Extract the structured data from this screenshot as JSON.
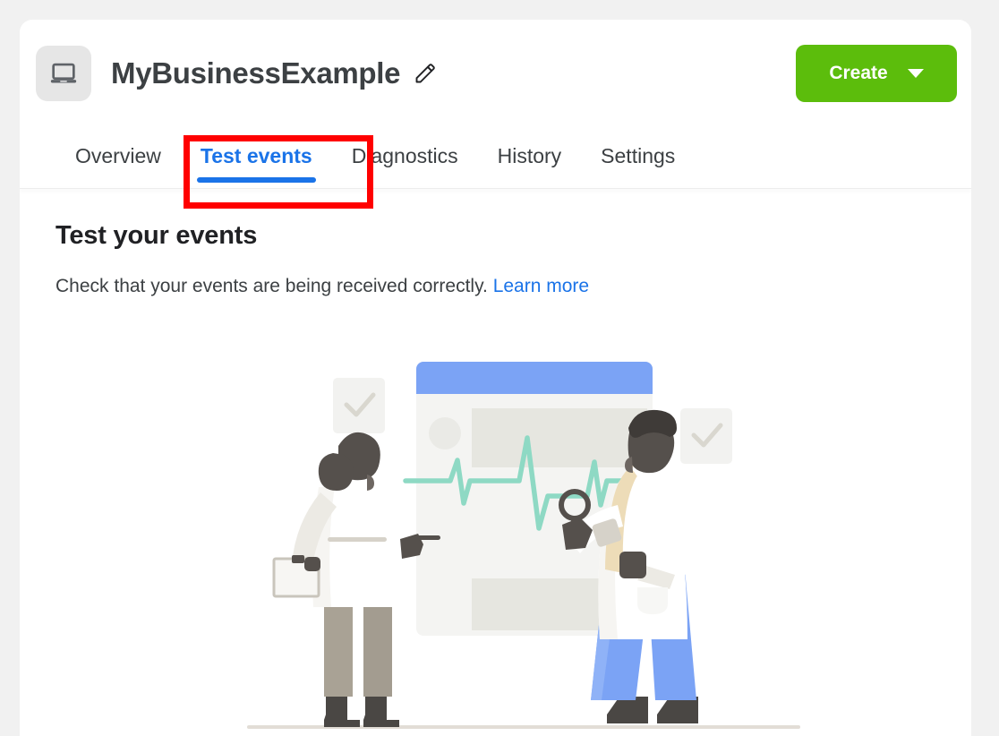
{
  "header": {
    "asset_icon": "laptop-icon",
    "title": "MyBusinessExample",
    "edit_icon": "pencil-icon",
    "create_label": "Create",
    "create_caret_icon": "chevron-down-icon",
    "create_color": "#5cbd0c"
  },
  "tabs": [
    {
      "label": "Overview",
      "active": false
    },
    {
      "label": "Test events",
      "active": true
    },
    {
      "label": "Diagnostics",
      "active": false
    },
    {
      "label": "History",
      "active": false
    },
    {
      "label": "Settings",
      "active": false
    }
  ],
  "annotation": {
    "target": "Test events",
    "color": "#ff0000"
  },
  "content": {
    "heading": "Test your events",
    "description": "Check that your events are being received correctly.",
    "link_label": "Learn more",
    "link_color": "#1a73e8"
  },
  "illustration": {
    "name": "two-doctors-reviewing-dashboard-illustration",
    "elements": [
      "check-card-left",
      "check-card-right",
      "dashboard-panel",
      "ecg-heartbeat-line",
      "doctor-left-figure",
      "doctor-right-figure",
      "ground-line"
    ],
    "colors": {
      "panel_header": "#7ba3f5",
      "panel_body": "#f4f4f2",
      "ecg_line": "#8ed9c4",
      "coat": "#ffffff",
      "pants_left": "#a9a295",
      "pants_right": "#7ba3f5",
      "skin": "#55504c",
      "ground": "#e2ddd6"
    }
  },
  "theme": {
    "page_background": "#f1f1f1",
    "card_background": "#ffffff",
    "accent_blue": "#1a73e8",
    "text_primary": "#3c4043"
  }
}
